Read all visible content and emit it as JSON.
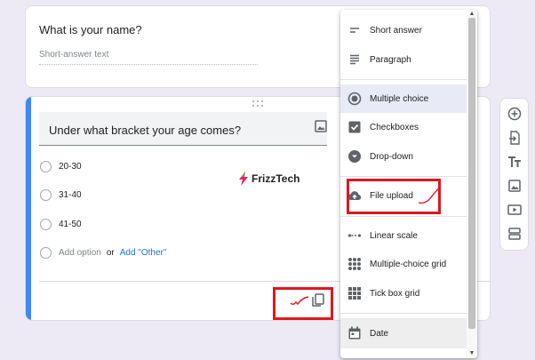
{
  "form": {
    "q1": {
      "title": "What is your name?",
      "placeholder": "Short-answer text"
    },
    "q2": {
      "title": "Under what bracket your age comes?",
      "options": [
        "20-30",
        "31-40",
        "41-50"
      ],
      "add_option": "Add option",
      "or": "or",
      "add_other": "Add \"Other\""
    }
  },
  "logo": {
    "text": "FrizzTech"
  },
  "menu": {
    "items": [
      {
        "label": "Short answer",
        "icon": "short-answer-icon"
      },
      {
        "label": "Paragraph",
        "icon": "paragraph-icon"
      },
      {
        "label": "Multiple choice",
        "icon": "radio-icon",
        "selected": true
      },
      {
        "label": "Checkboxes",
        "icon": "checkbox-icon"
      },
      {
        "label": "Drop-down",
        "icon": "dropdown-icon"
      },
      {
        "label": "File upload",
        "icon": "cloud-upload-icon"
      },
      {
        "label": "Linear scale",
        "icon": "linear-scale-icon"
      },
      {
        "label": "Multiple-choice grid",
        "icon": "grid-icon"
      },
      {
        "label": "Tick box grid",
        "icon": "tick-grid-icon"
      },
      {
        "label": "Date",
        "icon": "calendar-icon"
      }
    ]
  },
  "toolbar": {
    "items": [
      "add-question-icon",
      "import-questions-icon",
      "add-title-icon",
      "add-image-icon",
      "add-video-icon",
      "add-section-icon"
    ]
  },
  "colors": {
    "background": "#edeaf6",
    "accent": "#4285f4",
    "annotation": "#e0161f",
    "link": "#1a73e8"
  }
}
